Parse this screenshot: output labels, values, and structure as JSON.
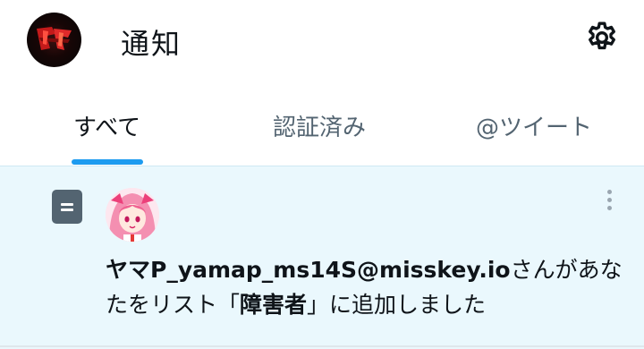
{
  "header": {
    "title": "通知",
    "settings_icon": "gear-icon"
  },
  "tabs": [
    {
      "label": "すべて",
      "active": true
    },
    {
      "label": "認証済み",
      "active": false
    },
    {
      "label": "@ツイート",
      "active": false
    }
  ],
  "colors": {
    "accent": "#1d9bf0",
    "unread_bg": "#eaf8fd",
    "secondary_text": "#536471"
  },
  "notification": {
    "type_icon": "list-icon",
    "user_handle": "ヤマP_yamap_ms14S@misskey.io",
    "text_before_list": "さんがあなたをリスト「",
    "list_name": "障害者",
    "text_after_list": "」に追加しました",
    "more_icon": "more-vertical-icon"
  }
}
